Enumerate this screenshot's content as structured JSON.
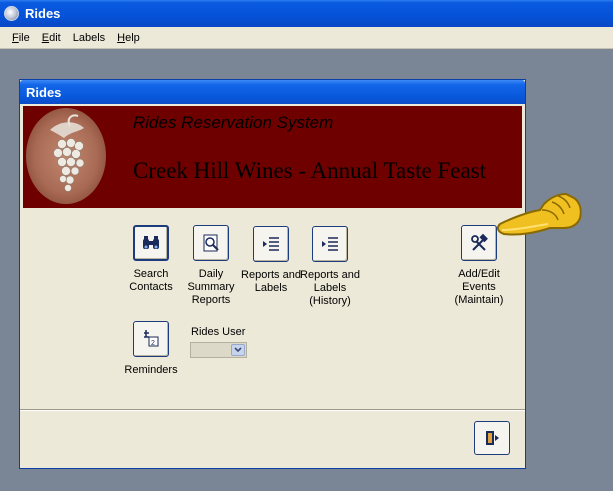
{
  "app": {
    "title": "Rides"
  },
  "menu": [
    {
      "label": "File",
      "ul": "F",
      "rest": "ile"
    },
    {
      "label": "Edit",
      "ul": "E",
      "rest": "dit"
    },
    {
      "label": "Labels",
      "ul": "",
      "rest": "Labels"
    },
    {
      "label": "Help",
      "ul": "H",
      "rest": "elp"
    }
  ],
  "child": {
    "title": "Rides",
    "banner": {
      "subtitle": "Rides Reservation  System",
      "title": "Creek Hill Wines - Annual Taste Feast"
    },
    "buttons": {
      "search": "Search Contacts",
      "daily": "Daily Summary Reports",
      "reports": "Reports and Labels",
      "reports_history": "Reports and Labels (History)",
      "events": "Add/Edit Events (Maintain)",
      "reminders": "Reminders"
    },
    "rides_user": {
      "label": "Rides User",
      "value": ""
    }
  },
  "colors": {
    "banner": "#6e0000",
    "titlebar": "#0858dc",
    "surface": "#ece9d8"
  }
}
